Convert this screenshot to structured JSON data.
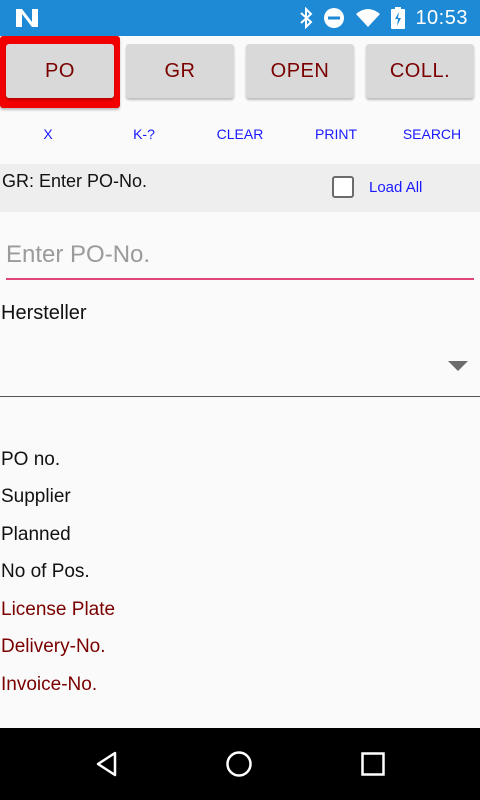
{
  "status_bar": {
    "time": "10:53",
    "background": "#1e8ad6",
    "icons": [
      "n-logo-icon",
      "bluetooth-icon",
      "do-not-disturb-icon",
      "wifi-icon",
      "battery-charging-icon"
    ]
  },
  "top_buttons": [
    {
      "label": "PO",
      "active": true
    },
    {
      "label": "GR",
      "active": false
    },
    {
      "label": "OPEN",
      "active": false
    },
    {
      "label": "COLL.",
      "active": false
    }
  ],
  "actions": [
    "X",
    "K-?",
    "CLEAR",
    "PRINT",
    "SEARCH"
  ],
  "gr_bar": {
    "label": "GR: Enter PO-No.",
    "load_all_label": "Load All",
    "load_all_checked": false
  },
  "po_input": {
    "value": "",
    "placeholder": "Enter PO-No."
  },
  "manufacturer": {
    "label": "Hersteller",
    "selected": ""
  },
  "info_fields": {
    "po_no": "PO no.",
    "supplier": "Supplier",
    "planned": "Planned",
    "no_of_pos": "No of Pos.",
    "license_plate": "License Plate",
    "delivery_no": "Delivery-No.",
    "invoice_no": "Invoice-No."
  },
  "colors": {
    "button_text": "#7a0000",
    "active_frame": "#f20000",
    "action_text": "#1a1aff",
    "input_underline": "#e0457b"
  },
  "nav_bar": {
    "icons": [
      "back-icon",
      "home-icon",
      "recents-icon"
    ]
  }
}
